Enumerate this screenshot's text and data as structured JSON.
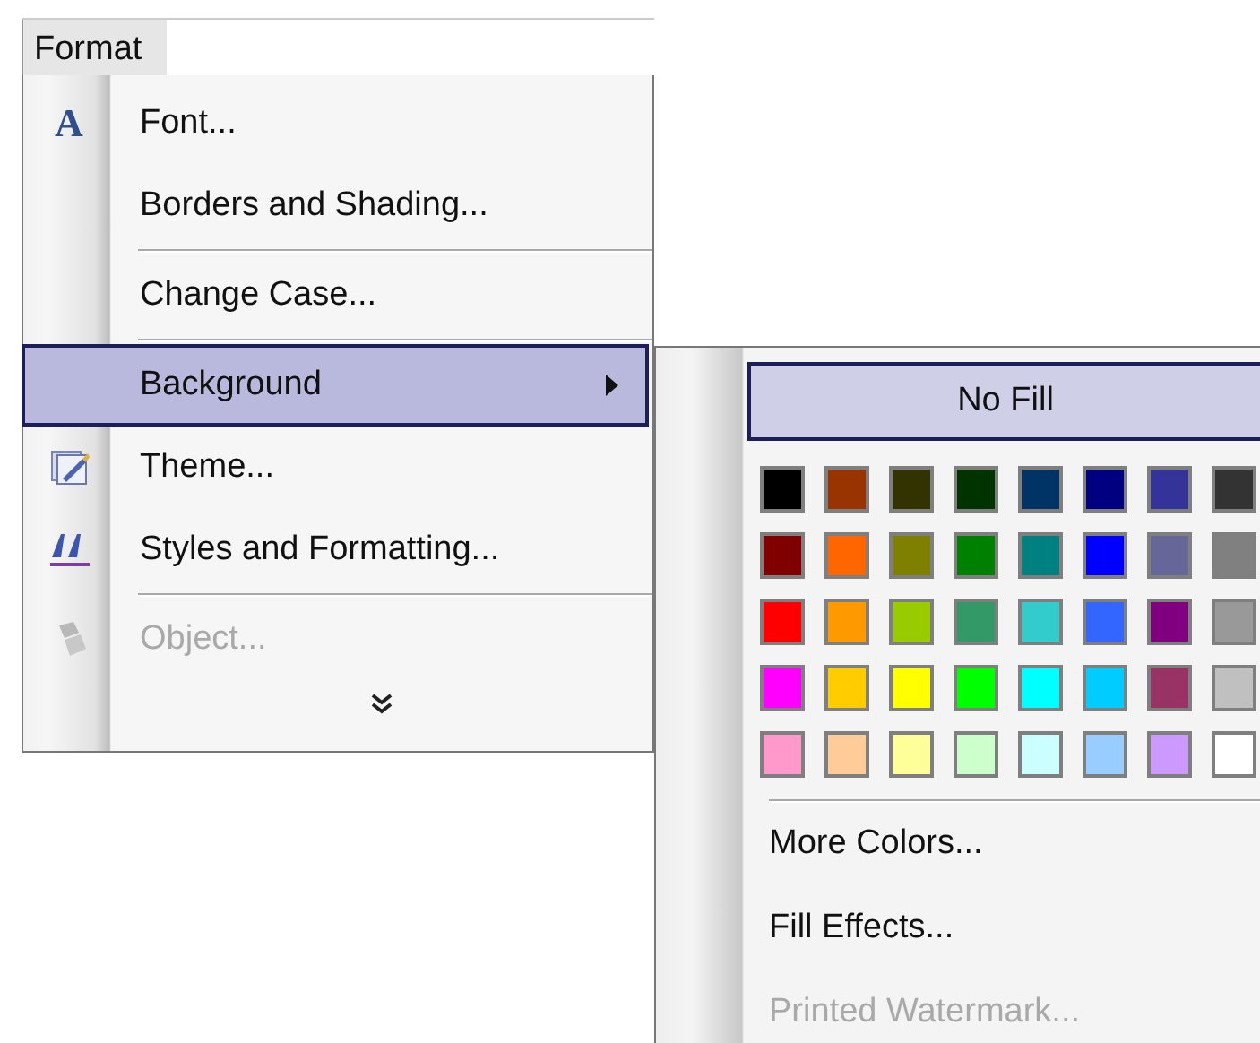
{
  "menu_bar": {
    "title": "Format"
  },
  "menu": [
    {
      "kind": "command",
      "label": "Font...",
      "icon_char": "A",
      "selected": false,
      "disabled": false
    },
    {
      "kind": "command",
      "label": "Borders and Shading...",
      "selected": false,
      "disabled": false
    },
    {
      "kind": "separator"
    },
    {
      "kind": "command",
      "label": "Change Case...",
      "selected": false,
      "disabled": false
    },
    {
      "kind": "separator"
    },
    {
      "kind": "submenu",
      "label": "Background",
      "selected": true,
      "disabled": false
    },
    {
      "kind": "command",
      "label": "Theme...",
      "selected": false,
      "disabled": false
    },
    {
      "kind": "command",
      "label": "Styles and Formatting...",
      "selected": false,
      "disabled": false
    },
    {
      "kind": "separator"
    },
    {
      "kind": "command",
      "label": "Object...",
      "selected": false,
      "disabled": true
    },
    {
      "kind": "expand"
    }
  ],
  "submenu": {
    "no_fill": {
      "label": "No Fill",
      "selected": true
    },
    "swatches": [
      {
        "color": "#000000"
      },
      {
        "color": "#993300"
      },
      {
        "color": "#333300"
      },
      {
        "color": "#003300"
      },
      {
        "color": "#003366"
      },
      {
        "color": "#000080"
      },
      {
        "color": "#333399"
      },
      {
        "color": "#333333"
      },
      {
        "color": "#800000"
      },
      {
        "color": "#ff6600"
      },
      {
        "color": "#808000"
      },
      {
        "color": "#008000"
      },
      {
        "color": "#008080"
      },
      {
        "color": "#0000ff"
      },
      {
        "color": "#666699"
      },
      {
        "color": "#808080"
      },
      {
        "color": "#ff0000"
      },
      {
        "color": "#ff9900"
      },
      {
        "color": "#99cc00"
      },
      {
        "color": "#339966"
      },
      {
        "color": "#33cccc"
      },
      {
        "color": "#3366ff"
      },
      {
        "color": "#800080"
      },
      {
        "color": "#999999"
      },
      {
        "color": "#ff00ff"
      },
      {
        "color": "#ffcc00"
      },
      {
        "color": "#ffff00"
      },
      {
        "color": "#00ff00"
      },
      {
        "color": "#00ffff"
      },
      {
        "color": "#00ccff"
      },
      {
        "color": "#993366"
      },
      {
        "color": "#c0c0c0"
      },
      {
        "color": "#ff99cc"
      },
      {
        "color": "#ffcc99"
      },
      {
        "color": "#ffff99"
      },
      {
        "color": "#ccffcc"
      },
      {
        "color": "#ccffff"
      },
      {
        "color": "#99ccff"
      },
      {
        "color": "#cc99ff"
      },
      {
        "color": "#ffffff"
      }
    ],
    "items": [
      {
        "label": "More Colors...",
        "disabled": false
      },
      {
        "label": "Fill Effects...",
        "disabled": false
      },
      {
        "label": "Printed Watermark...",
        "disabled": true
      }
    ]
  }
}
